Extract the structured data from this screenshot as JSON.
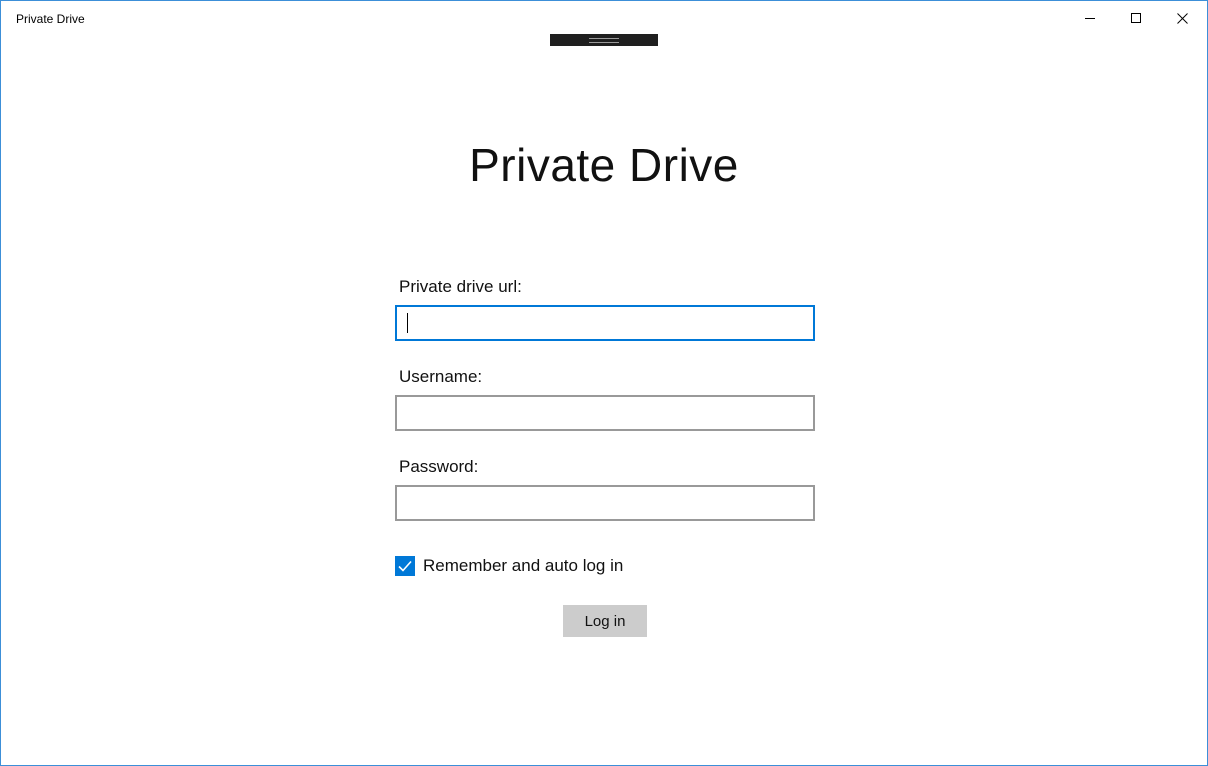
{
  "window": {
    "title": "Private Drive",
    "accent_color": "#0078d7",
    "border_color": "#3c8fd8",
    "caption_buttons": [
      {
        "name": "minimize",
        "icon": "minimize-icon"
      },
      {
        "name": "maximize",
        "icon": "maximize-icon"
      },
      {
        "name": "close",
        "icon": "close-icon"
      }
    ]
  },
  "main": {
    "title": "Private Drive"
  },
  "form": {
    "url_label": "Private drive url:",
    "url_value": "",
    "username_label": "Username:",
    "username_value": "",
    "password_label": "Password:",
    "password_value": "",
    "remember_label": "Remember and auto log in",
    "remember_checked": true,
    "login_button_label": "Log in",
    "login_button_color": "#cccccc"
  }
}
